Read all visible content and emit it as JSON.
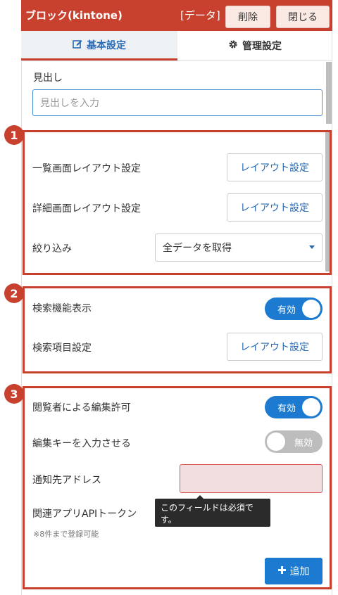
{
  "header": {
    "title": "ブロック(kintone)",
    "tag": "[データ]",
    "delete_label": "削除",
    "close_label": "閉じる"
  },
  "tabs": [
    {
      "label": "基本設定",
      "icon": "edit-icon",
      "active": true
    },
    {
      "label": "管理設定",
      "icon": "gear-icon",
      "active": false
    }
  ],
  "heading": {
    "label": "見出し",
    "placeholder": "見出しを入力"
  },
  "section1": {
    "badge": "1",
    "list_layout_label": "一覧画面レイアウト設定",
    "list_layout_button": "レイアウト設定",
    "detail_layout_label": "詳細画面レイアウト設定",
    "detail_layout_button": "レイアウト設定",
    "filter_label": "絞り込み",
    "filter_value": "全データを取得"
  },
  "section2": {
    "badge": "2",
    "search_display_label": "検索機能表示",
    "search_display_toggle": "有効",
    "search_items_label": "検索項目設定",
    "search_items_button": "レイアウト設定"
  },
  "section3": {
    "badge": "3",
    "viewer_edit_label": "閲覧者による編集許可",
    "viewer_edit_toggle": "有効",
    "edit_key_label": "編集キーを入力させる",
    "edit_key_toggle": "無効",
    "notify_label": "通知先アドレス",
    "api_token_label": "関連アプリAPIトークン",
    "api_token_note": "※8件まで登録可能",
    "tooltip": "このフィールドは必須です。",
    "add_button": "追加"
  },
  "colors": {
    "header_bg": "#c8412f",
    "accent_blue": "#1c7bd0",
    "annotation_red": "#c8412f",
    "error_bg": "#f2dede"
  }
}
